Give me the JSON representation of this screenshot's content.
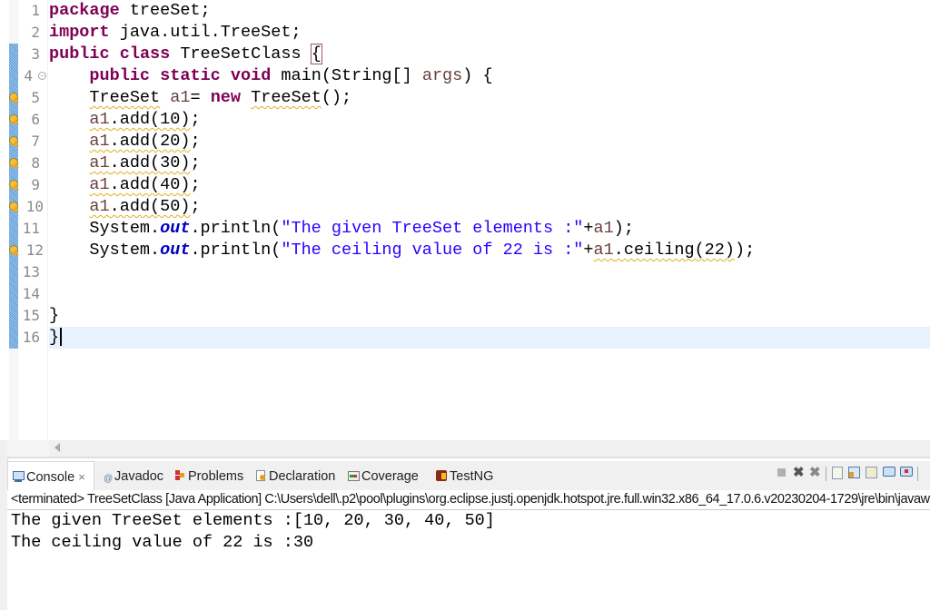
{
  "editor": {
    "lines": [
      {
        "n": "1",
        "tokens": [
          {
            "t": "package",
            "c": "kw"
          },
          {
            "t": " treeSet;",
            "c": ""
          }
        ]
      },
      {
        "n": "2",
        "tokens": [
          {
            "t": "import",
            "c": "kw"
          },
          {
            "t": " java.util.TreeSet;",
            "c": ""
          }
        ]
      },
      {
        "n": "3",
        "tokens": [
          {
            "t": "public",
            "c": "kw"
          },
          {
            "t": " ",
            "c": ""
          },
          {
            "t": "class",
            "c": "kw"
          },
          {
            "t": " TreeSetClass ",
            "c": ""
          },
          {
            "t": "{",
            "c": "brace-box"
          }
        ]
      },
      {
        "n": "4",
        "tokens": [
          {
            "t": "    ",
            "c": ""
          },
          {
            "t": "public",
            "c": "kw"
          },
          {
            "t": " ",
            "c": ""
          },
          {
            "t": "static",
            "c": "kw"
          },
          {
            "t": " ",
            "c": ""
          },
          {
            "t": "void",
            "c": "kw"
          },
          {
            "t": " main(String[] ",
            "c": ""
          },
          {
            "t": "args",
            "c": "var"
          },
          {
            "t": ") {",
            "c": ""
          }
        ]
      },
      {
        "n": "5",
        "tokens": [
          {
            "t": "    ",
            "c": ""
          },
          {
            "t": "TreeSet",
            "c": "warn-ul"
          },
          {
            "t": " ",
            "c": ""
          },
          {
            "t": "a1",
            "c": "var"
          },
          {
            "t": "= ",
            "c": ""
          },
          {
            "t": "new",
            "c": "kw"
          },
          {
            "t": " ",
            "c": ""
          },
          {
            "t": "TreeSet",
            "c": "warn-ul"
          },
          {
            "t": "();",
            "c": ""
          }
        ]
      },
      {
        "n": "6",
        "tokens": [
          {
            "t": "    ",
            "c": ""
          },
          {
            "t": "a1.add(10)",
            "c": "warn-ul var-first"
          },
          {
            "t": ";",
            "c": ""
          }
        ]
      },
      {
        "n": "7",
        "tokens": [
          {
            "t": "    ",
            "c": ""
          },
          {
            "t": "a1.add(20)",
            "c": "warn-ul var-first"
          },
          {
            "t": ";",
            "c": ""
          }
        ]
      },
      {
        "n": "8",
        "tokens": [
          {
            "t": "    ",
            "c": ""
          },
          {
            "t": "a1.add(30)",
            "c": "warn-ul var-first"
          },
          {
            "t": ";",
            "c": ""
          }
        ]
      },
      {
        "n": "9",
        "tokens": [
          {
            "t": "    ",
            "c": ""
          },
          {
            "t": "a1.add(40)",
            "c": "warn-ul var-first"
          },
          {
            "t": ";",
            "c": ""
          }
        ]
      },
      {
        "n": "10",
        "tokens": [
          {
            "t": "    ",
            "c": ""
          },
          {
            "t": "a1.add(50)",
            "c": "warn-ul var-first"
          },
          {
            "t": ";",
            "c": ""
          }
        ]
      },
      {
        "n": "11",
        "tokens": [
          {
            "t": "    System.",
            "c": ""
          },
          {
            "t": "out",
            "c": "fld"
          },
          {
            "t": ".println(",
            "c": ""
          },
          {
            "t": "\"The given TreeSet elements :\"",
            "c": "str"
          },
          {
            "t": "+",
            "c": ""
          },
          {
            "t": "a1",
            "c": "var"
          },
          {
            "t": ");",
            "c": ""
          }
        ]
      },
      {
        "n": "12",
        "tokens": [
          {
            "t": "    System.",
            "c": ""
          },
          {
            "t": "out",
            "c": "fld"
          },
          {
            "t": ".println(",
            "c": ""
          },
          {
            "t": "\"The ceiling value of 22 is :\"",
            "c": "str"
          },
          {
            "t": "+",
            "c": ""
          },
          {
            "t": "a1.ceiling(22)",
            "c": "warn-ul var-first"
          },
          {
            "t": ");",
            "c": ""
          }
        ]
      },
      {
        "n": "13",
        "tokens": []
      },
      {
        "n": "14",
        "tokens": []
      },
      {
        "n": "15",
        "tokens": [
          {
            "t": "}",
            "c": ""
          }
        ]
      },
      {
        "n": "16",
        "tokens": [
          {
            "t": "}",
            "c": ""
          }
        ]
      }
    ],
    "warning_lines": [
      "5",
      "6",
      "7",
      "8",
      "9",
      "10",
      "12"
    ],
    "fold_line": "4",
    "current_line": "16"
  },
  "panel": {
    "tabs": [
      {
        "label": "Console",
        "icon": "console-icon",
        "active": true,
        "closable": true
      },
      {
        "label": "Javadoc",
        "icon": "javadoc-icon"
      },
      {
        "label": "Problems",
        "icon": "problems-icon"
      },
      {
        "label": "Declaration",
        "icon": "declaration-icon"
      },
      {
        "label": "Coverage",
        "icon": "coverage-icon"
      },
      {
        "label": "TestNG",
        "icon": "testng-icon"
      }
    ],
    "close_glyph": "×",
    "toolbar": [
      "terminate-icon",
      "remove-launch-icon",
      "remove-all-terminated-icon",
      "clear-console-icon",
      "scroll-lock-icon",
      "word-wrap-icon",
      "show-on-stdout-icon",
      "show-on-stderr-icon"
    ],
    "status": "<terminated> TreeSetClass [Java Application] C:\\Users\\dell\\.p2\\pool\\plugins\\org.eclipse.justj.openjdk.hotspot.jre.full.win32.x86_64_17.0.6.v20230204-1729\\jre\\bin\\javaw.exe",
    "output": [
      "The given TreeSet elements :[10, 20, 30, 40, 50]",
      "The ceiling value of 22 is :30"
    ]
  }
}
